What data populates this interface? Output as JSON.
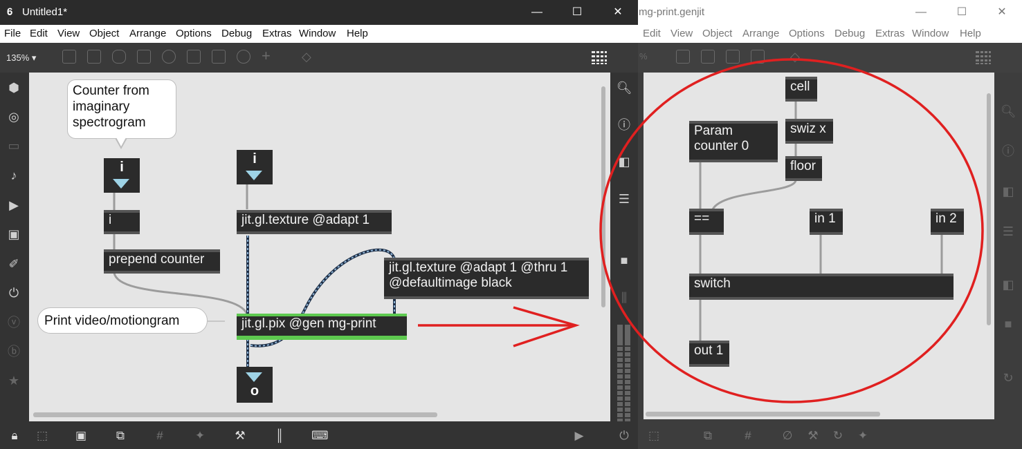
{
  "left_window": {
    "title": "Untitled1*",
    "controls": {
      "minimize": "—",
      "maximize": "☐",
      "close": "✕"
    },
    "menu": [
      "File",
      "Edit",
      "View",
      "Object",
      "Arrange",
      "Options",
      "Debug",
      "Extras",
      "Window",
      "Help"
    ],
    "zoom": "135%",
    "zoom_caret": "▾",
    "patch": {
      "comment_counter": "Counter from\nimaginary\nspectrogram",
      "comment_print": "Print video/motiongram",
      "inlet_left_label": "i",
      "inlet_mid_label": "i",
      "outlet_label": "o",
      "obj_i": "i",
      "obj_prepend": "prepend counter",
      "obj_texture1": "jit.gl.texture @adapt 1",
      "obj_texture2": "jit.gl.texture @adapt 1 @thru 1\n@defaultimage black",
      "obj_pix": "jit.gl.pix @gen mg-print"
    }
  },
  "right_window": {
    "title": "mg-print.genjit",
    "title_prefix": "%",
    "controls": {
      "minimize": "—",
      "maximize": "☐",
      "close": "✕"
    },
    "menu": [
      "Edit",
      "View",
      "Object",
      "Arrange",
      "Options",
      "Debug",
      "Extras",
      "Window",
      "Help"
    ],
    "patch": {
      "obj_cell": "cell",
      "obj_swiz": "swiz x",
      "obj_floor": "floor",
      "obj_param": "Param\ncounter 0",
      "obj_eq": "==",
      "obj_in1": "in 1",
      "obj_in2": "in 2",
      "obj_switch": "switch",
      "obj_out1": "out 1"
    }
  },
  "annotations": {
    "arrow_color": "#e02020",
    "circle_color": "#e02020"
  },
  "colors": {
    "object_bg": "#2b2b2b",
    "canvas_bg": "#e5e5e5",
    "pix_highlight": "#5ec94f"
  }
}
